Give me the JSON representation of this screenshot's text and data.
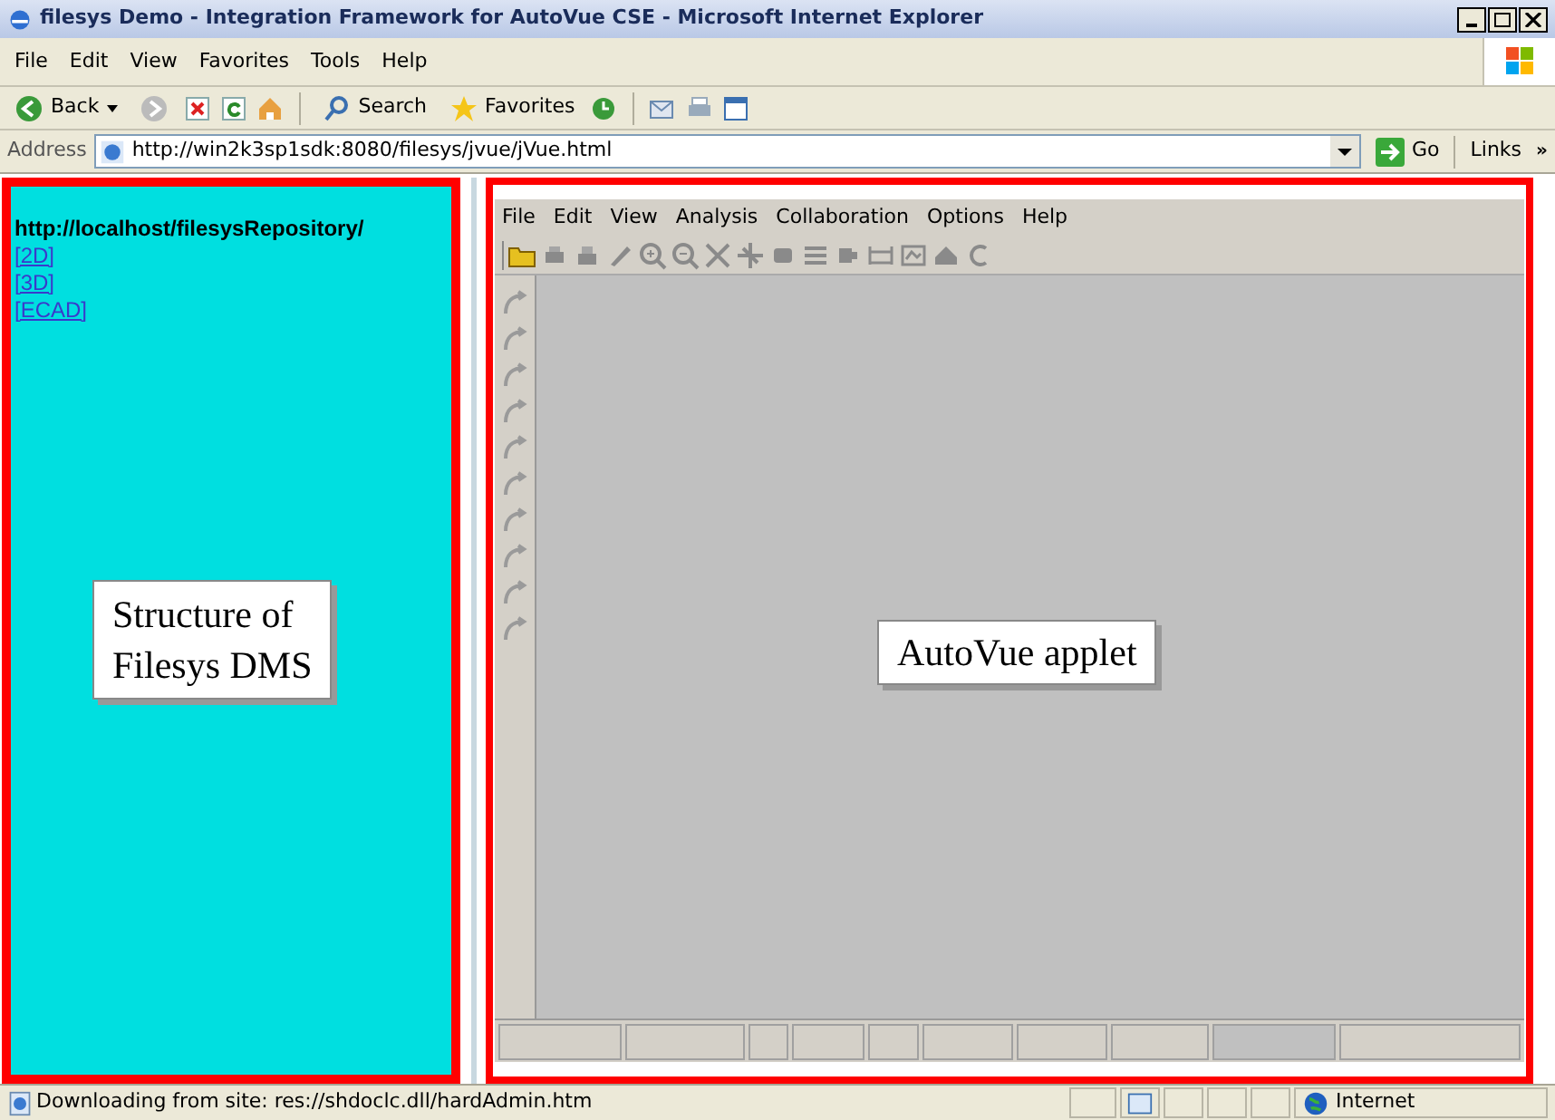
{
  "window": {
    "title": "filesys Demo - Integration Framework for AutoVue CSE - Microsoft Internet Explorer"
  },
  "menu": [
    "File",
    "Edit",
    "View",
    "Favorites",
    "Tools",
    "Help"
  ],
  "toolbar": {
    "back": "Back",
    "search": "Search",
    "favorites": "Favorites"
  },
  "address": {
    "label": "Address",
    "url": "http://win2k3sp1sdk:8080/filesys/jvue/jVue.html",
    "go": "Go",
    "links": "Links",
    "more": "»"
  },
  "sidebar": {
    "heading": "http://localhost/filesysRepository/",
    "links": [
      "[2D]",
      "[3D]",
      "[ECAD]"
    ],
    "callout": [
      "Structure of",
      "Filesys DMS"
    ]
  },
  "applet": {
    "menu": [
      "File",
      "Edit",
      "View",
      "Analysis",
      "Collaboration",
      "Options",
      "Help"
    ],
    "callout": "AutoVue applet"
  },
  "status_bar": {
    "text": "Downloading from site: res://shdoclc.dll/hardAdmin.htm",
    "zone": "Internet"
  }
}
